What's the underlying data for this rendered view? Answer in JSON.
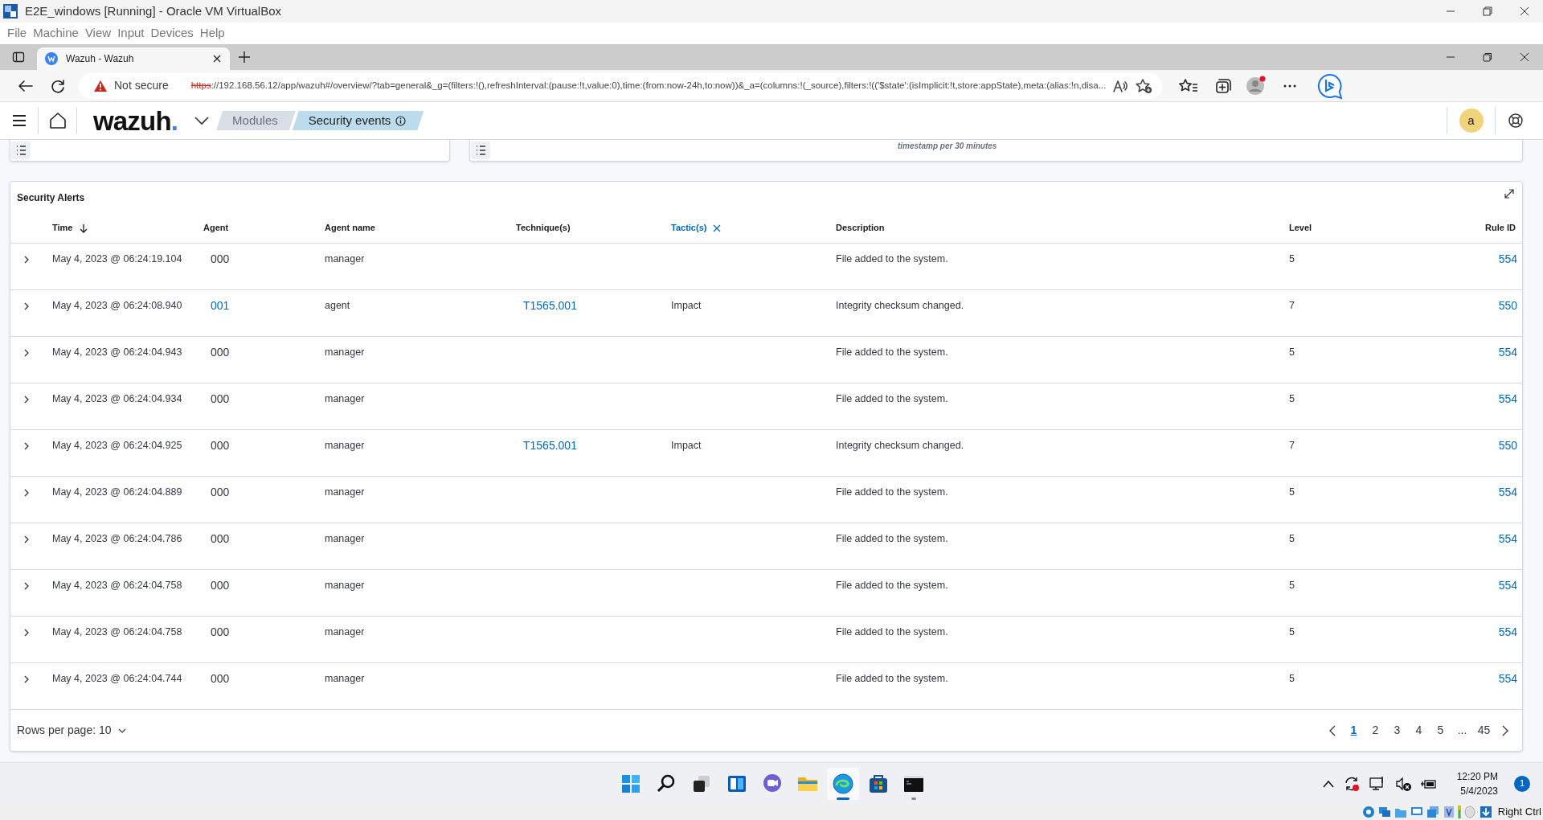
{
  "window": {
    "title": "E2E_windows [Running] - Oracle VM VirtualBox"
  },
  "menu": [
    "File",
    "Machine",
    "View",
    "Input",
    "Devices",
    "Help"
  ],
  "browser_tabs": [
    {
      "title": "Wazuh - Wazuh",
      "selected": true
    }
  ],
  "address_bar": {
    "warning": "Not secure",
    "scheme": "https",
    "url_rest": "://192.168.56.12/app/wazuh#/overview/?tab=general&_g=(filters:!(),refreshInterval:(pause:!t,value:0),time:(from:now-24h,to:now))&_a=(columns:!(_source),filters:!(('$state':(isImplicit:!t,store:appState),meta:(alias:!n,disa..."
  },
  "app_header": {
    "logo": "wazuh",
    "logo_mark": ".",
    "avatar": "a",
    "breadcrumbs": [
      {
        "label": "Modules",
        "selected": false
      },
      {
        "label": "Security events",
        "selected": true
      }
    ]
  },
  "panel_caption": "timestamp per 30 minutes",
  "alerts": {
    "title": "Security Alerts",
    "columns": [
      {
        "label": "Time",
        "sorted": true,
        "active": false
      },
      {
        "label": "Agent",
        "sorted": false,
        "active": false
      },
      {
        "label": "Agent name",
        "sorted": false,
        "active": false
      },
      {
        "label": "Technique(s)",
        "sorted": false,
        "active": false
      },
      {
        "label": "Tactic(s)",
        "sorted": false,
        "active": true
      },
      {
        "label": "Description",
        "sorted": false,
        "active": false
      },
      {
        "label": "Level",
        "sorted": false,
        "active": false
      },
      {
        "label": "Rule ID",
        "sorted": false,
        "active": false
      }
    ],
    "rows": [
      {
        "time": "May 4, 2023 @ 06:24:19.104",
        "agent": "000",
        "agent_linked": false,
        "agent_name": "manager",
        "technique": "",
        "tactic": "",
        "description": "File added to the system.",
        "level": "5",
        "rule_id": "554"
      },
      {
        "time": "May 4, 2023 @ 06:24:08.940",
        "agent": "001",
        "agent_linked": true,
        "agent_name": "agent",
        "technique": "T1565.001",
        "tactic": "Impact",
        "description": "Integrity checksum changed.",
        "level": "7",
        "rule_id": "550"
      },
      {
        "time": "May 4, 2023 @ 06:24:04.943",
        "agent": "000",
        "agent_linked": false,
        "agent_name": "manager",
        "technique": "",
        "tactic": "",
        "description": "File added to the system.",
        "level": "5",
        "rule_id": "554"
      },
      {
        "time": "May 4, 2023 @ 06:24:04.934",
        "agent": "000",
        "agent_linked": false,
        "agent_name": "manager",
        "technique": "",
        "tactic": "",
        "description": "File added to the system.",
        "level": "5",
        "rule_id": "554"
      },
      {
        "time": "May 4, 2023 @ 06:24:04.925",
        "agent": "000",
        "agent_linked": false,
        "agent_name": "manager",
        "technique": "T1565.001",
        "tactic": "Impact",
        "description": "Integrity checksum changed.",
        "level": "7",
        "rule_id": "550"
      },
      {
        "time": "May 4, 2023 @ 06:24:04.889",
        "agent": "000",
        "agent_linked": false,
        "agent_name": "manager",
        "technique": "",
        "tactic": "",
        "description": "File added to the system.",
        "level": "5",
        "rule_id": "554"
      },
      {
        "time": "May 4, 2023 @ 06:24:04.786",
        "agent": "000",
        "agent_linked": false,
        "agent_name": "manager",
        "technique": "",
        "tactic": "",
        "description": "File added to the system.",
        "level": "5",
        "rule_id": "554"
      },
      {
        "time": "May 4, 2023 @ 06:24:04.758",
        "agent": "000",
        "agent_linked": false,
        "agent_name": "manager",
        "technique": "",
        "tactic": "",
        "description": "File added to the system.",
        "level": "5",
        "rule_id": "554"
      },
      {
        "time": "May 4, 2023 @ 06:24:04.758",
        "agent": "000",
        "agent_linked": false,
        "agent_name": "manager",
        "technique": "",
        "tactic": "",
        "description": "File added to the system.",
        "level": "5",
        "rule_id": "554"
      },
      {
        "time": "May 4, 2023 @ 06:24:04.744",
        "agent": "000",
        "agent_linked": false,
        "agent_name": "manager",
        "technique": "",
        "tactic": "",
        "description": "File added to the system.",
        "level": "5",
        "rule_id": "554"
      }
    ],
    "rows_per_page": "Rows per page: 10",
    "pages": [
      {
        "label": "1",
        "selected": true
      },
      {
        "label": "2",
        "selected": false
      },
      {
        "label": "3",
        "selected": false
      },
      {
        "label": "4",
        "selected": false
      },
      {
        "label": "5",
        "selected": false
      },
      {
        "label": "...",
        "selected": false
      },
      {
        "label": "45",
        "selected": false
      }
    ]
  },
  "taskbar": {
    "apps": [
      {
        "kind": "start",
        "focused": false,
        "running": false
      },
      {
        "kind": "search",
        "focused": false,
        "running": false
      },
      {
        "kind": "taskview",
        "focused": false,
        "running": false
      },
      {
        "kind": "widgets",
        "focused": false,
        "running": false
      },
      {
        "kind": "chat",
        "focused": false,
        "running": false
      },
      {
        "kind": "explorer",
        "focused": false,
        "running": false
      },
      {
        "kind": "edge",
        "focused": true,
        "running": true
      },
      {
        "kind": "store",
        "focused": false,
        "running": false
      },
      {
        "kind": "terminal",
        "focused": false,
        "running": true
      }
    ],
    "time": "12:20 PM",
    "date": "5/4/2023",
    "notifications": "1"
  },
  "vm_status": {
    "host_key": "Right Ctrl"
  }
}
